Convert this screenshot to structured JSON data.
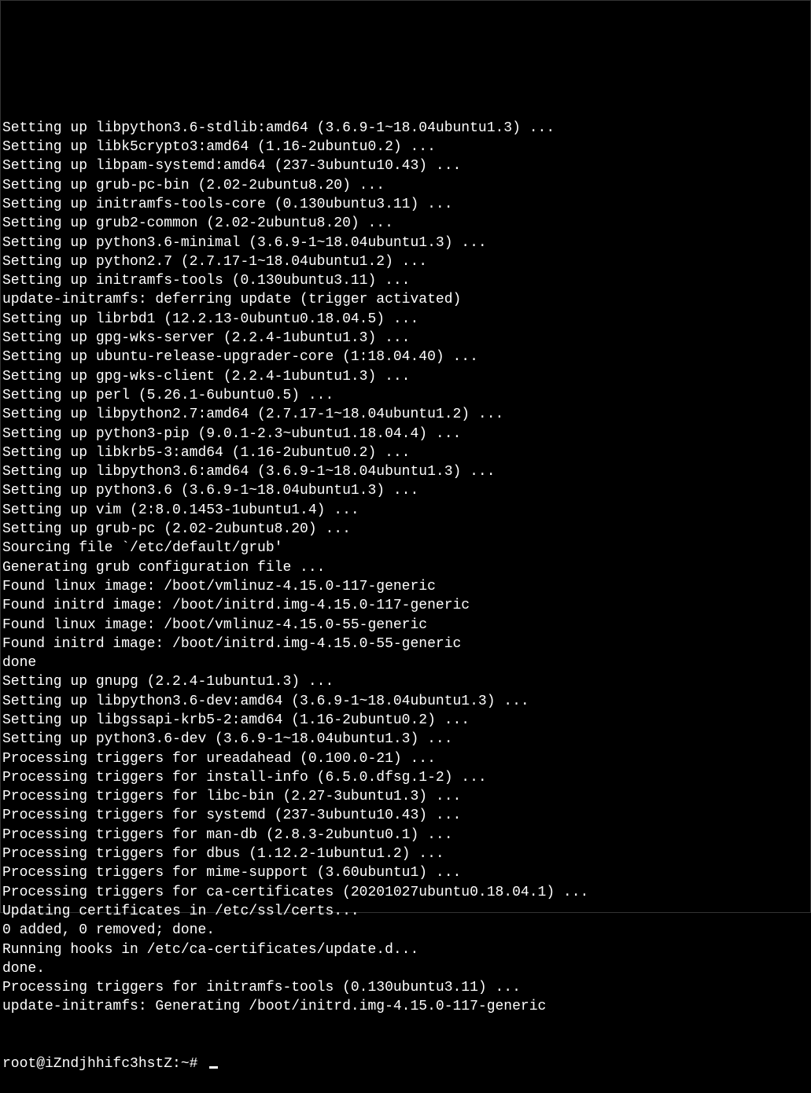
{
  "terminal": {
    "lines": [
      "Setting up libpython3.6-stdlib:amd64 (3.6.9-1~18.04ubuntu1.3) ...",
      "Setting up libk5crypto3:amd64 (1.16-2ubuntu0.2) ...",
      "Setting up libpam-systemd:amd64 (237-3ubuntu10.43) ...",
      "Setting up grub-pc-bin (2.02-2ubuntu8.20) ...",
      "Setting up initramfs-tools-core (0.130ubuntu3.11) ...",
      "Setting up grub2-common (2.02-2ubuntu8.20) ...",
      "Setting up python3.6-minimal (3.6.9-1~18.04ubuntu1.3) ...",
      "Setting up python2.7 (2.7.17-1~18.04ubuntu1.2) ...",
      "Setting up initramfs-tools (0.130ubuntu3.11) ...",
      "update-initramfs: deferring update (trigger activated)",
      "Setting up librbd1 (12.2.13-0ubuntu0.18.04.5) ...",
      "Setting up gpg-wks-server (2.2.4-1ubuntu1.3) ...",
      "Setting up ubuntu-release-upgrader-core (1:18.04.40) ...",
      "Setting up gpg-wks-client (2.2.4-1ubuntu1.3) ...",
      "Setting up perl (5.26.1-6ubuntu0.5) ...",
      "Setting up libpython2.7:amd64 (2.7.17-1~18.04ubuntu1.2) ...",
      "Setting up python3-pip (9.0.1-2.3~ubuntu1.18.04.4) ...",
      "Setting up libkrb5-3:amd64 (1.16-2ubuntu0.2) ...",
      "Setting up libpython3.6:amd64 (3.6.9-1~18.04ubuntu1.3) ...",
      "Setting up python3.6 (3.6.9-1~18.04ubuntu1.3) ...",
      "Setting up vim (2:8.0.1453-1ubuntu1.4) ...",
      "Setting up grub-pc (2.02-2ubuntu8.20) ...",
      "Sourcing file `/etc/default/grub'",
      "Generating grub configuration file ...",
      "Found linux image: /boot/vmlinuz-4.15.0-117-generic",
      "Found initrd image: /boot/initrd.img-4.15.0-117-generic",
      "Found linux image: /boot/vmlinuz-4.15.0-55-generic",
      "Found initrd image: /boot/initrd.img-4.15.0-55-generic",
      "done",
      "Setting up gnupg (2.2.4-1ubuntu1.3) ...",
      "Setting up libpython3.6-dev:amd64 (3.6.9-1~18.04ubuntu1.3) ...",
      "Setting up libgssapi-krb5-2:amd64 (1.16-2ubuntu0.2) ...",
      "Setting up python3.6-dev (3.6.9-1~18.04ubuntu1.3) ...",
      "Processing triggers for ureadahead (0.100.0-21) ...",
      "Processing triggers for install-info (6.5.0.dfsg.1-2) ...",
      "Processing triggers for libc-bin (2.27-3ubuntu1.3) ...",
      "Processing triggers for systemd (237-3ubuntu10.43) ...",
      "Processing triggers for man-db (2.8.3-2ubuntu0.1) ...",
      "Processing triggers for dbus (1.12.2-1ubuntu1.2) ...",
      "Processing triggers for mime-support (3.60ubuntu1) ...",
      "Processing triggers for ca-certificates (20201027ubuntu0.18.04.1) ...",
      "Updating certificates in /etc/ssl/certs...",
      "0 added, 0 removed; done.",
      "Running hooks in /etc/ca-certificates/update.d...",
      "done.",
      "Processing triggers for initramfs-tools (0.130ubuntu3.11) ...",
      "update-initramfs: Generating /boot/initrd.img-4.15.0-117-generic"
    ],
    "prompt": "root@iZndjhhifc3hstZ:~# "
  }
}
